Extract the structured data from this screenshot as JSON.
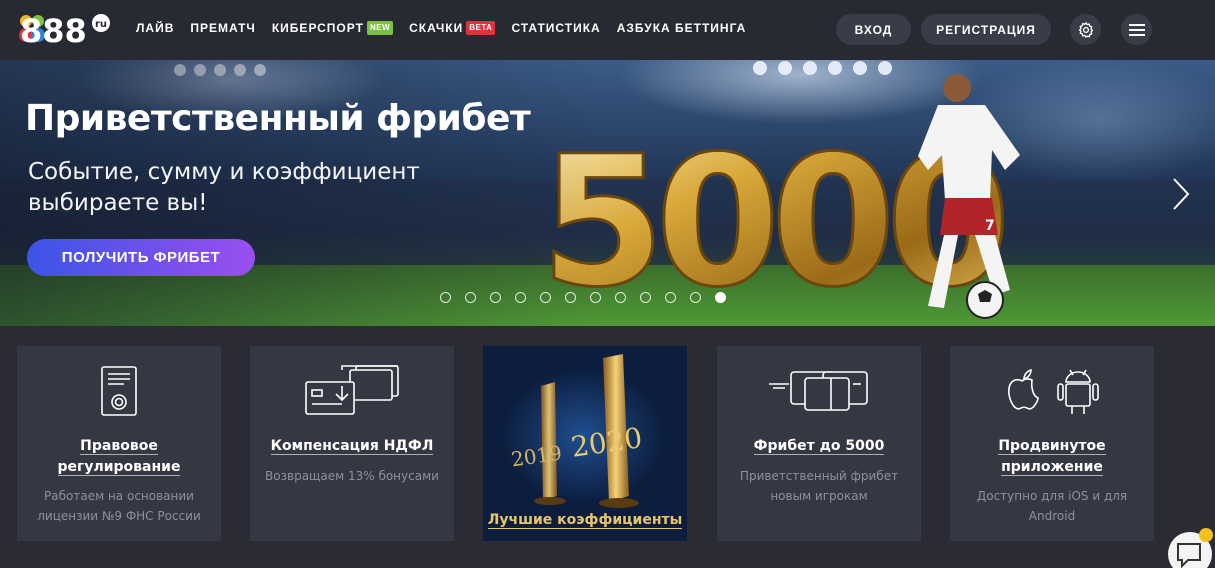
{
  "header": {
    "logo_text": "888",
    "logo_suffix": "ru",
    "nav": [
      {
        "label": "ЛАЙВ"
      },
      {
        "label": "ПРЕМАТЧ"
      },
      {
        "label": "КИБЕРСПОРТ",
        "badge": "NEW"
      },
      {
        "label": "СКАЧКИ",
        "badge": "BETA"
      },
      {
        "label": "СТАТИСТИКА"
      },
      {
        "label": "АЗБУКА БЕТТИНГА"
      }
    ],
    "login_label": "ВХОД",
    "register_label": "РЕГИСТРАЦИЯ",
    "settings_icon": "gear-icon",
    "menu_icon": "hamburger-icon"
  },
  "hero": {
    "title": "Приветственный фрибет",
    "subtitle": "Событие, сумму и коэффициент выбираете вы!",
    "cta_label": "ПОЛУЧИТЬ ФРИБЕТ",
    "amount": "5000",
    "player_number": "7",
    "slide_count": 12,
    "active_slide": 12
  },
  "cards": [
    {
      "title": "Правовое регулирование",
      "desc": "Работаем на основании лицензии №9 ФНС России",
      "icon": "license-document-icon"
    },
    {
      "title": "Компенсация НДФЛ",
      "desc": "Возвращаем 13% бонусами",
      "icon": "card-reader-icon"
    },
    {
      "title": "Лучшие коэффициенты",
      "year_left": "2019",
      "year_right": "2020",
      "icon": "trophy-icon"
    },
    {
      "title": "Фрибет до 5000",
      "desc": "Приветственный фрибет новым игрокам",
      "icon": "cards-icon"
    },
    {
      "title": "Продвинутое приложение",
      "desc": "Доступно для iOS и для Android",
      "icon": "apple-android-icon"
    }
  ],
  "colors": {
    "header_bg": "#282a33",
    "card_bg": "#353743",
    "cta_gradient_start": "#3b55e6",
    "cta_gradient_end": "#9b4ef0",
    "badge_new": "#7cc242",
    "badge_beta": "#e0323c",
    "gold": "#d4a53a"
  }
}
